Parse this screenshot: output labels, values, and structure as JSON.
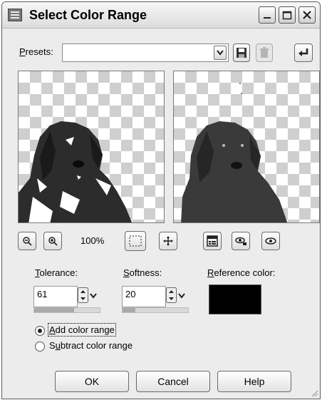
{
  "window": {
    "title": "Select Color Range"
  },
  "presets": {
    "label_pre": "",
    "label_accel": "P",
    "label_post": "resets:",
    "value": ""
  },
  "toolbar": {
    "zoom_level": "100%"
  },
  "tolerance": {
    "accel": "T",
    "rest": "olerance:",
    "value": "61",
    "slider_fraction": 0.61
  },
  "softness": {
    "accel": "S",
    "rest": "oftness:",
    "value": "20",
    "slider_fraction": 0.2
  },
  "reference": {
    "accel": "R",
    "rest": "eference color:",
    "color": "#000000"
  },
  "mode": {
    "add": {
      "accel": "A",
      "rest": "dd color range",
      "checked": true
    },
    "subtract": {
      "pre": "S",
      "accel": "u",
      "rest": "btract color range",
      "checked": false
    }
  },
  "buttons": {
    "ok": "OK",
    "cancel": "Cancel",
    "help": "Help"
  },
  "icons": {
    "app": "app-icon",
    "minimize": "minimize-icon",
    "maximize": "maximize-icon",
    "close": "close-icon",
    "save": "save-icon",
    "delete": "trash-icon",
    "reset": "reset-arrow-icon",
    "zoom_out": "zoom-out-icon",
    "zoom_in": "zoom-in-icon",
    "selection": "selection-marquee-icon",
    "pan": "pan-move-icon",
    "proof": "proof-panel-icon",
    "eye_dropper_add": "eye-add-icon",
    "eye_dropper": "eye-icon"
  }
}
